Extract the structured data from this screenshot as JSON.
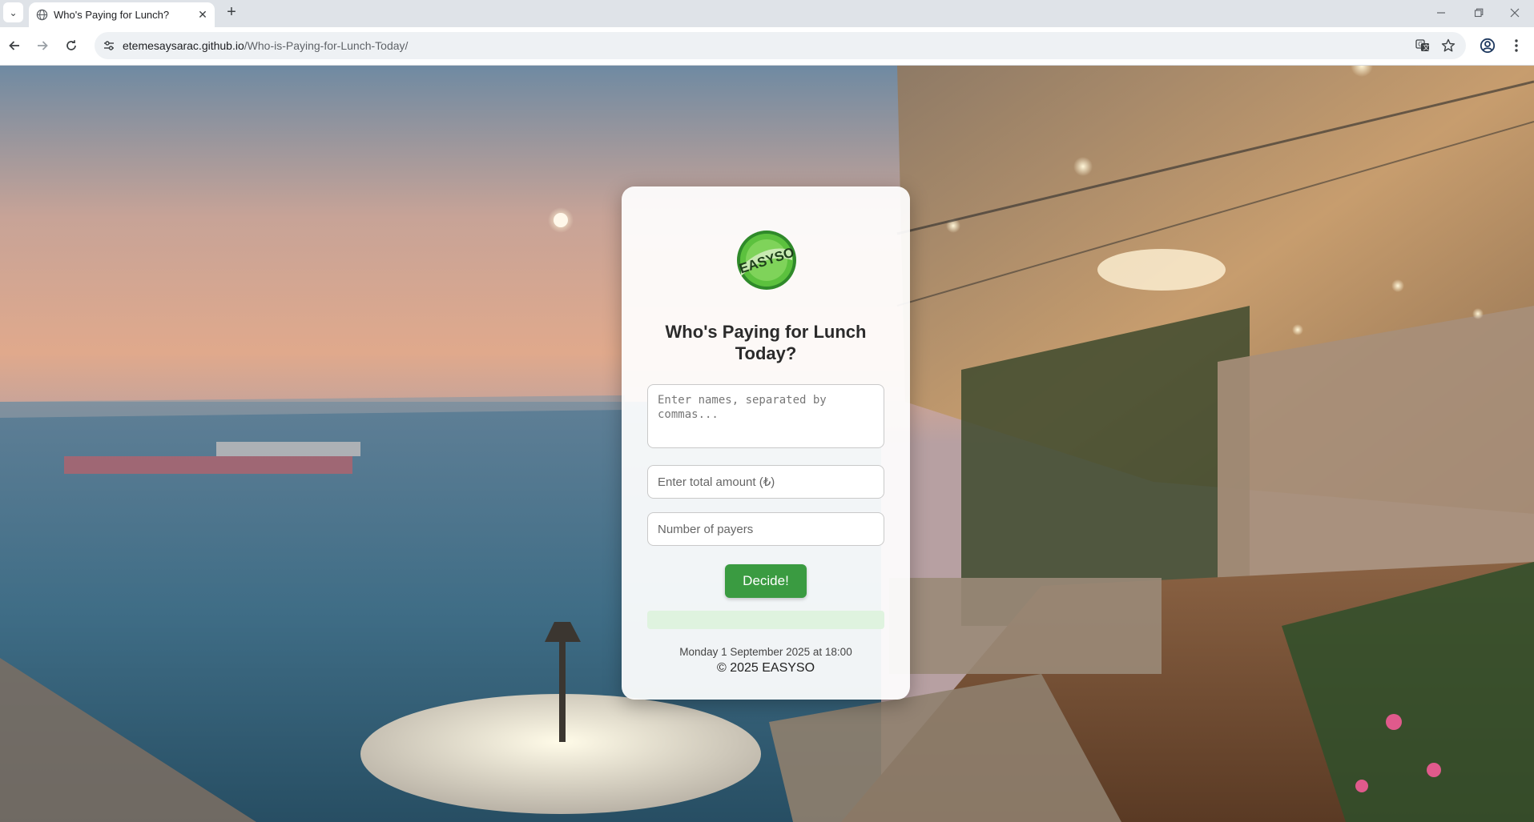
{
  "browser": {
    "tab_title": "Who's Paying for Lunch?",
    "new_tab_symbol": "+",
    "url_host": "etemesaysarac.github.io",
    "url_path": "/Who-is-Paying-for-Lunch-Today/",
    "icons": [
      "tab-search-icon",
      "globe-icon",
      "close-icon",
      "plus-icon",
      "minimize-icon",
      "restore-icon",
      "close-window-icon",
      "back-icon",
      "forward-icon",
      "reload-icon",
      "site-info-icon",
      "translate-icon",
      "star-icon",
      "profile-icon",
      "menu-icon"
    ]
  },
  "page": {
    "logo_text": "EASYSO",
    "title": "Who's Paying for Lunch Today?",
    "names_placeholder": "Enter names, separated by commas...",
    "amount_placeholder": "Enter total amount (₺)",
    "payers_placeholder": "Number of payers",
    "decide_label": "Decide!",
    "result_text": "",
    "datetime": "Monday 1 September 2025 at 18:00",
    "copyright": "© 2025 EASYSO"
  },
  "colors": {
    "accent_green": "#3a9b41",
    "result_bg": "#dff3df",
    "chrome_tabbar": "#dfe3e8"
  }
}
